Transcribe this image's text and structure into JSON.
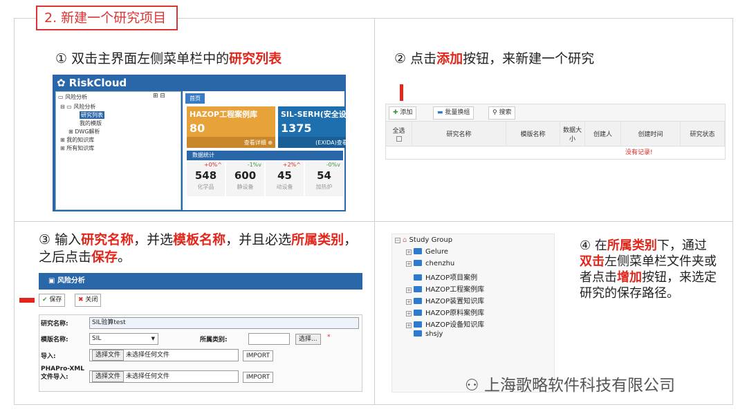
{
  "header": {
    "title": "2. 新建一个研究项目"
  },
  "step1": {
    "prefix": "① 双击主界面左侧菜单栏中的",
    "hl": "研究列表"
  },
  "step2": {
    "p1": "② 点击",
    "hl": "添加",
    "p2": "按钮，来新建一个研究"
  },
  "step3": {
    "p1": "③ 输入",
    "h1": "研究名称",
    "p2": "，并选",
    "h2": "模板名称",
    "p3": "，并且必选",
    "h3": "所属类别",
    "p4": "，之后点击",
    "h4": "保存",
    "p5": "。"
  },
  "step4": {
    "p1": "④ 在",
    "h1": "所属类别",
    "p2": "下，通过",
    "h2": "双击",
    "p3": "左侧菜单栏文件夹或者点击",
    "h3": "增加",
    "p4": "按钮，来选定研究的保存路径。"
  },
  "riskcloud": {
    "brand": "RiskCloud",
    "tree": [
      "风险分析",
      "风险分析",
      "研究列表",
      "我的模版",
      "DWG解析",
      "我的知识库",
      "所有知识库"
    ],
    "tab": "首页",
    "card1": {
      "title": "HAZOP工程案例库",
      "value": "80",
      "link": "查看详细 ⊕"
    },
    "card2": {
      "title": "SIL-SERH(安全设备)",
      "value": "1375",
      "link": "(EXIDA)查看详细 ⊕"
    },
    "stats_title": "数据统计",
    "stats": [
      {
        "pct": "+0%^",
        "value": "548",
        "label": "化学品"
      },
      {
        "pct": "-1%v",
        "value": "600",
        "label": "静设备"
      },
      {
        "pct": "+2%^",
        "value": "45",
        "label": "动设备"
      },
      {
        "pct": "-0%v",
        "value": "54",
        "label": "加热炉"
      }
    ]
  },
  "toolbar": {
    "add": "添加",
    "batch": "批量换组",
    "search": "搜索"
  },
  "grid": {
    "headers": [
      "全选",
      "研究名称",
      "模版名称",
      "数据大小",
      "创建人",
      "创建时间",
      "研究状态"
    ],
    "empty": "没有记录!"
  },
  "form": {
    "window_title": "风险分析",
    "save": "保存",
    "close": "关闭",
    "name_label": "研究名称:",
    "name_value": "SIL验算test",
    "tpl_label": "模版名称:",
    "tpl_value": "SIL",
    "cat_label": "所属类别:",
    "select_btn": "选择...",
    "required": "*",
    "import_label": "导入:",
    "choose": "选择文件",
    "no_file": "未选择任何文件",
    "import_btn": "IMPORT",
    "xml_label": "PHAPro-XML文件导入:"
  },
  "tree4": {
    "root": "Study Group",
    "items": [
      "Gelure",
      "chenzhu",
      "HAZOP项目案例",
      "HAZOP工程案例库",
      "HAZOP装置知识库",
      "HAZOP原料案例库",
      "HAZOP设备知识库",
      "shsjy"
    ]
  },
  "watermark": "上海歌略软件科技有限公司",
  "colors": {
    "accent": "#e1261c",
    "blue": "#2a67a9",
    "orange": "#e8a23a",
    "teal": "#1e6fae"
  }
}
